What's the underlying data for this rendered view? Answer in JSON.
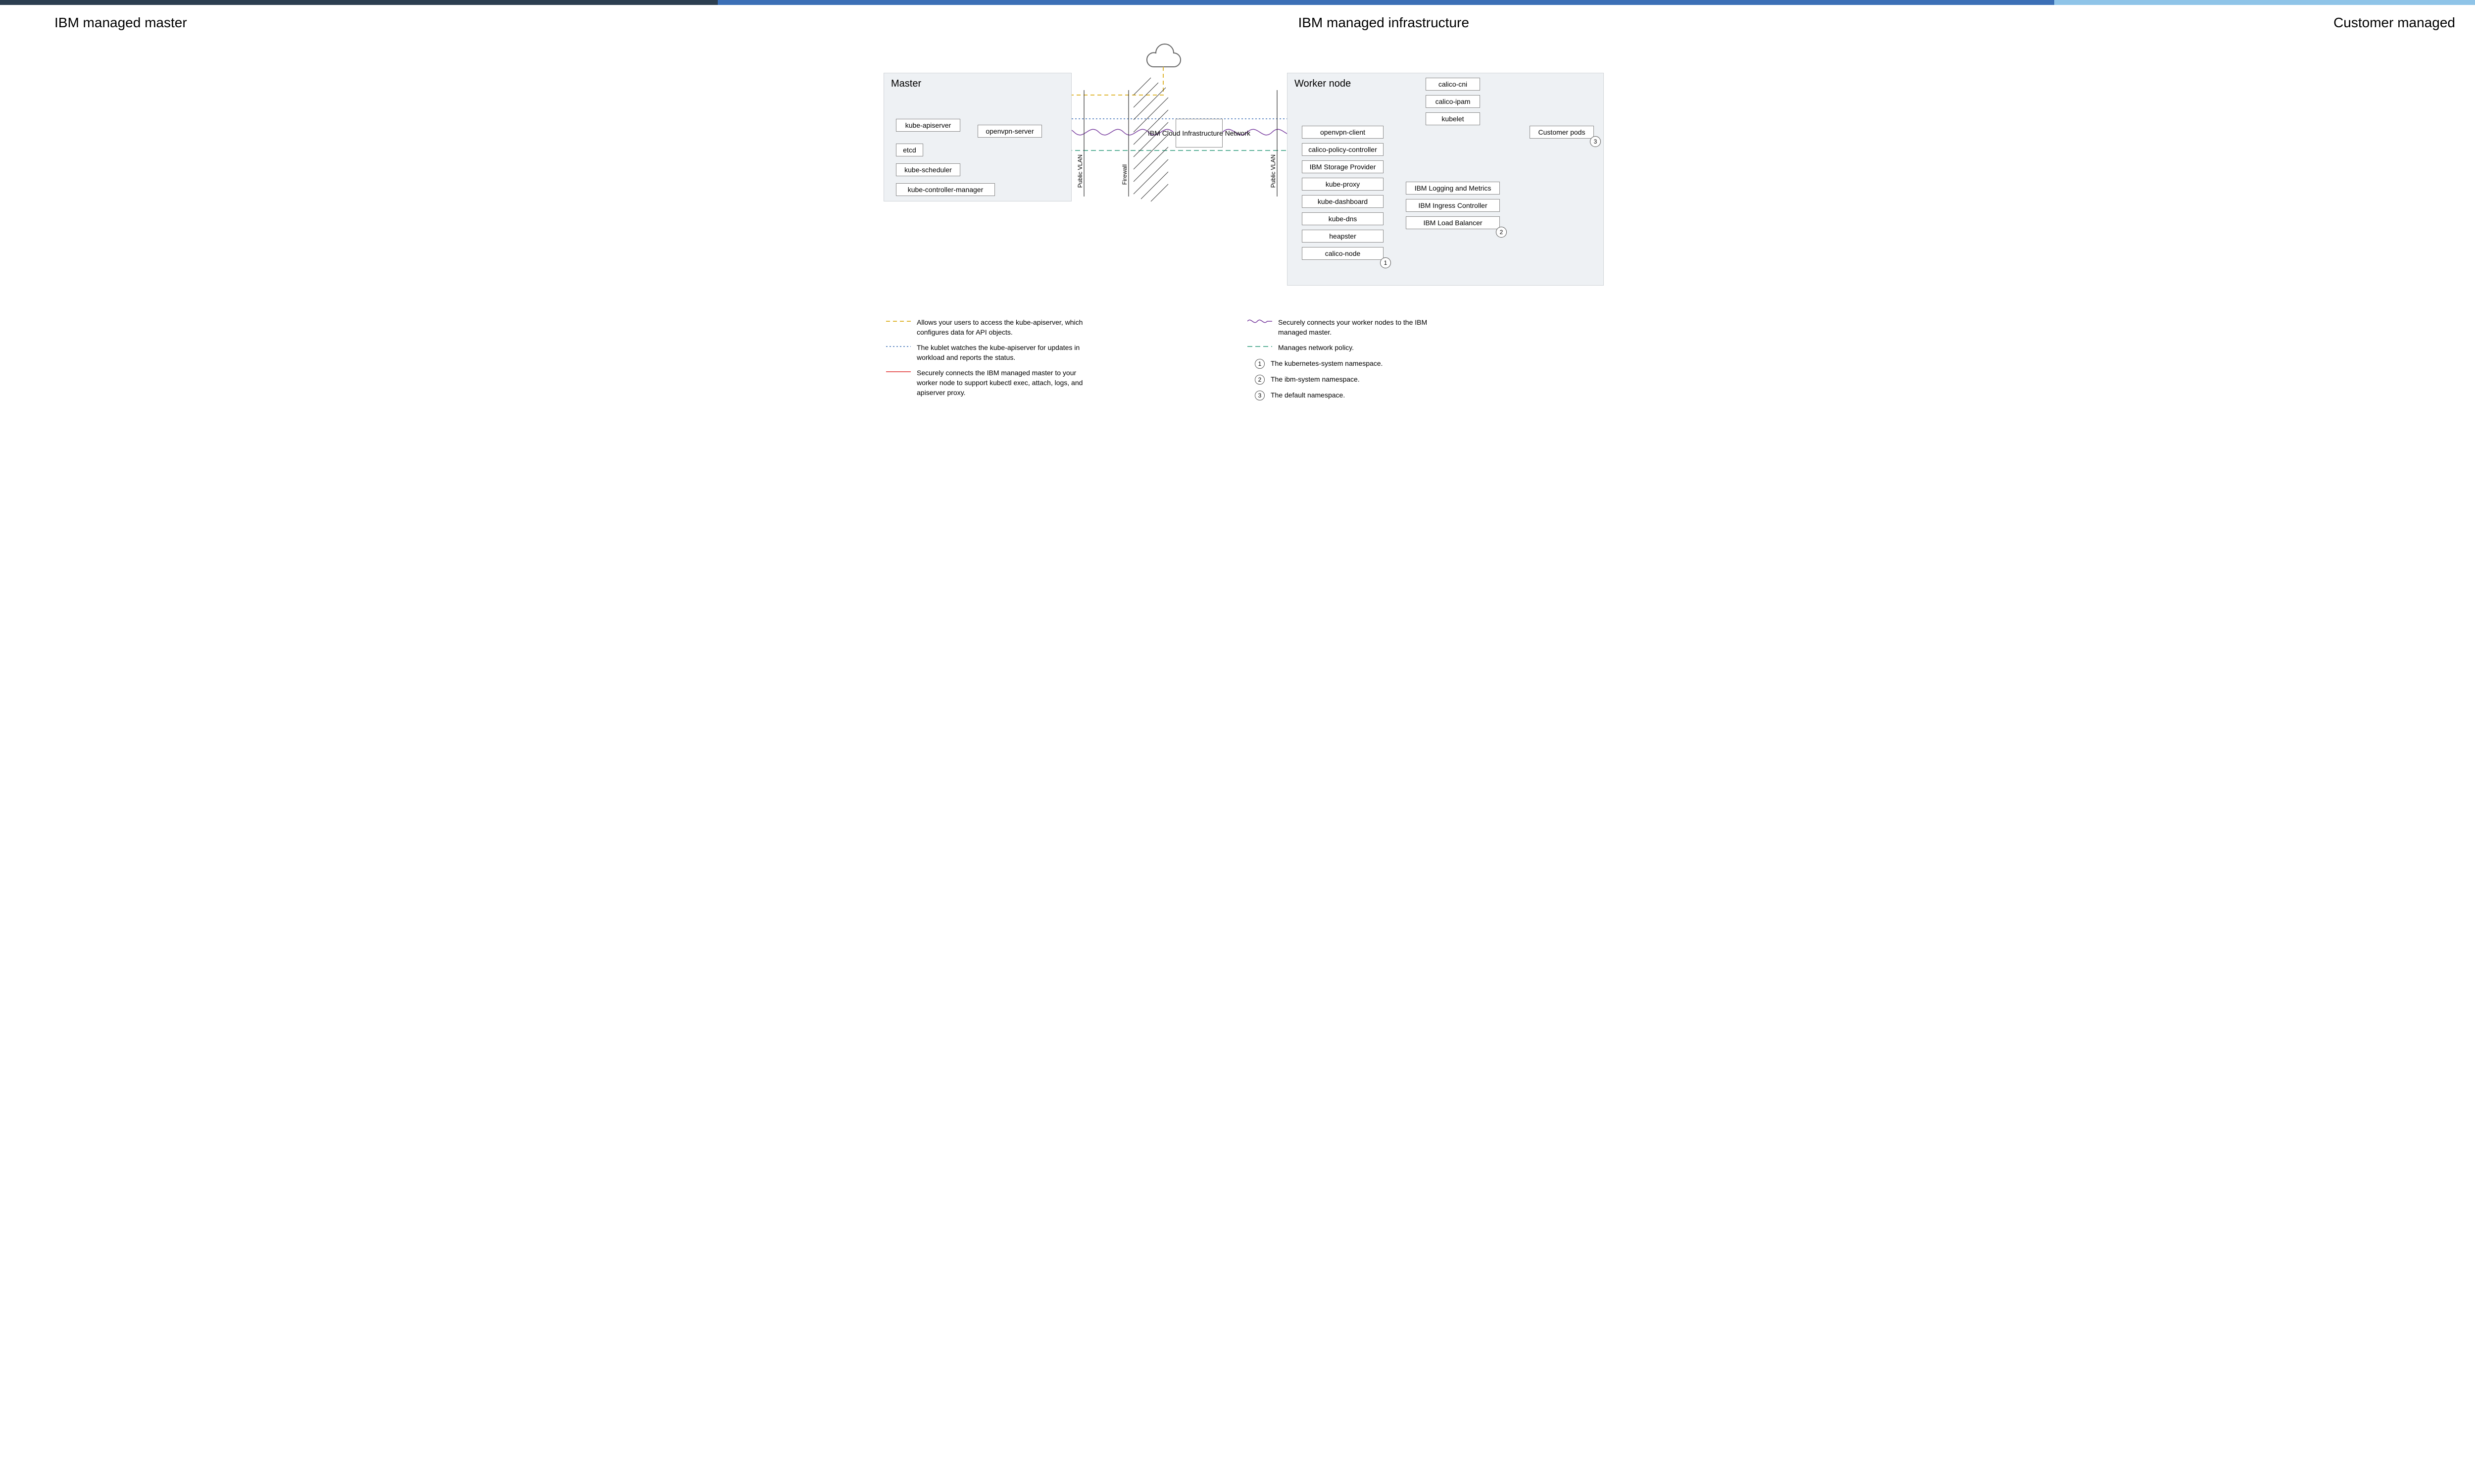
{
  "headers": {
    "left": "IBM managed master",
    "center": "IBM managed infrastructure",
    "right": "Customer managed"
  },
  "master": {
    "title": "Master",
    "items": [
      "kube-apiserver",
      "openvpn-server",
      "etcd",
      "kube-scheduler",
      "kube-controller-manager"
    ]
  },
  "center": {
    "label": "IBM Cloud Infrastructure Network",
    "vlan_left": "Public VLAN",
    "firewall": "Firewall",
    "vlan_right": "Public VLAN"
  },
  "worker": {
    "title": "Worker node",
    "col1": [
      "openvpn-client",
      "calico-policy-controller",
      "IBM Storage Provider",
      "kube-proxy",
      "kube-dashboard",
      "kube-dns",
      "heapster",
      "calico-node"
    ],
    "col2_top": [
      "calico-cni",
      "calico-ipam",
      "kubelet"
    ],
    "col2_mid": [
      "IBM Logging and Metrics",
      "IBM Ingress Controller",
      "IBM Load Balancer"
    ],
    "col3": "Customer pods"
  },
  "badges": {
    "b1": "1",
    "b2": "2",
    "b3": "3"
  },
  "legend": {
    "yellow": "Allows your users to access the kube-apiserver, which configures data for API objects.",
    "blue": "The kublet watches the kube-apiserver for updates in workload and reports the status.",
    "red": "Securely connects the IBM managed master to your worker node to support kubectl exec, attach, logs, and apiserver proxy.",
    "purple": "Securely connects your worker nodes to the IBM managed master.",
    "green": "Manages network policy.",
    "n1": "The kubernetes-system namespace.",
    "n2": "The ibm-system namespace.",
    "n3": "The default namespace."
  }
}
